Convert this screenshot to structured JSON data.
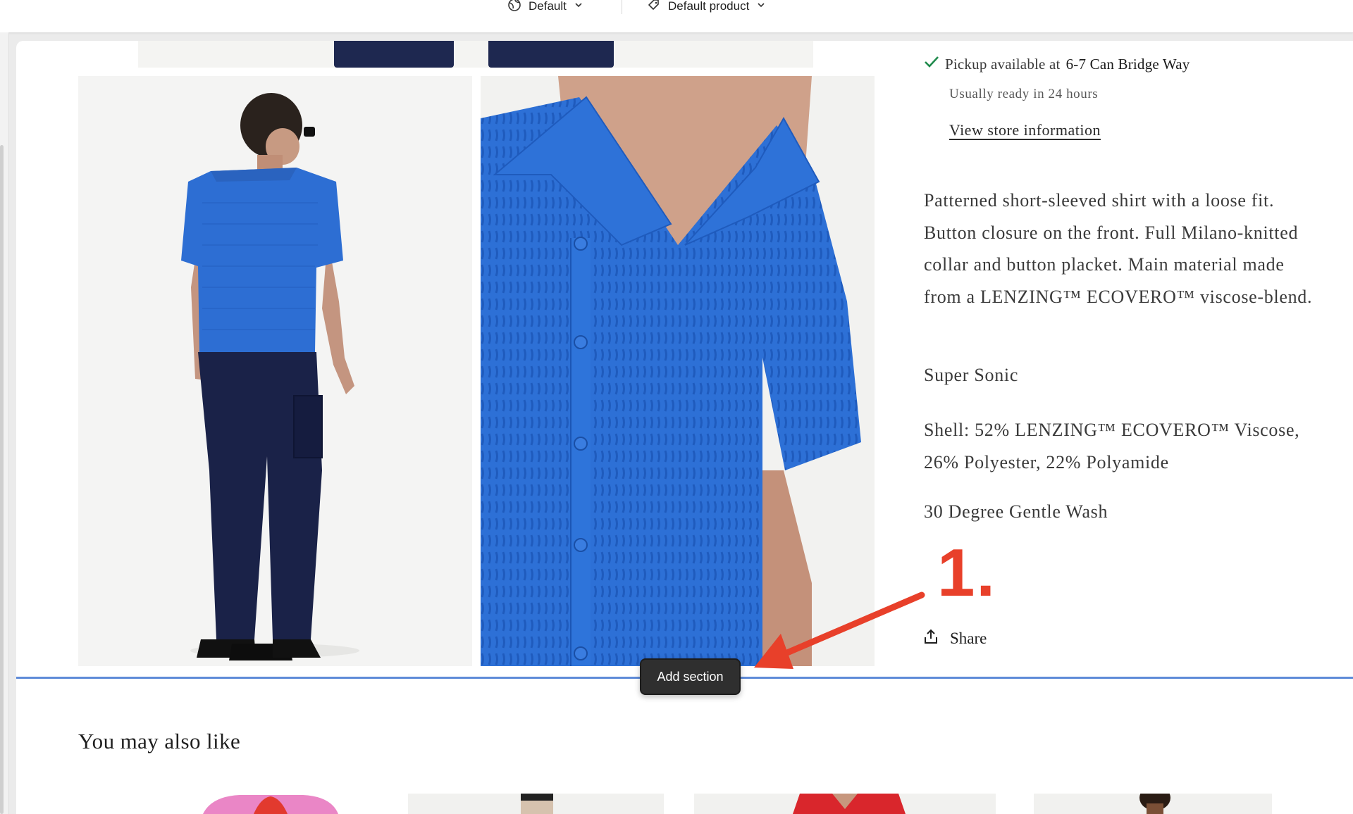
{
  "toolbar": {
    "theme_selector_label": "Default",
    "template_selector_label": "Default product"
  },
  "product": {
    "pickup_prefix": "Pickup available at",
    "pickup_location": "6-7 Can Bridge Way",
    "pickup_ready": "Usually ready in 24 hours",
    "store_link": "View store information",
    "description": "Patterned short-sleeved shirt with a loose fit. Button closure on the front. Full Milano-knitted collar and button placket. Main material made from a LENZING™ ECOVERO™  viscose-blend.",
    "color_name": "Super Sonic",
    "composition": "Shell: 52% LENZING™  ECOVERO™  Viscose, 26% Polyester, 22% Polyamide",
    "care": "30 Degree Gentle Wash",
    "share_label": "Share"
  },
  "annotation": {
    "step_label": "1.",
    "color": "#e8402a"
  },
  "editor": {
    "add_section_label": "Add section",
    "divider_color": "#5e8bd8"
  },
  "recommendations": {
    "heading": "You may also like"
  },
  "icons": {
    "theme": "globe-icon",
    "template": "tag-icon",
    "chevron": "chevron-down-icon",
    "pickup": "check-icon",
    "share": "share-icon"
  }
}
